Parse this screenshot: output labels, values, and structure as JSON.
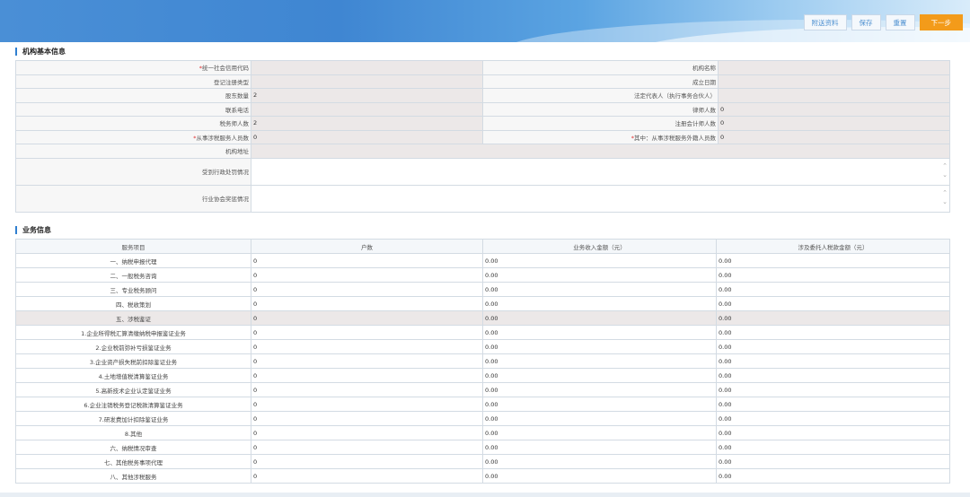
{
  "toolbar": {
    "attach_label": "附送资料",
    "save_label": "保存",
    "reset_label": "重置",
    "next_label": "下一步"
  },
  "info_section": {
    "title": "机构基本信息",
    "rows": [
      {
        "left_label": "统一社会信用代码",
        "left_required": true,
        "left_value": "",
        "right_label": "机构名称",
        "right_required": false,
        "right_value": ""
      },
      {
        "left_label": "登记注册类型",
        "left_required": false,
        "left_value": "",
        "right_label": "成立日期",
        "right_required": false,
        "right_value": ""
      },
      {
        "left_label": "股东数量",
        "left_required": false,
        "left_value": "2",
        "right_label": "法定代表人（执行事务合伙人）",
        "right_required": false,
        "right_value": ""
      },
      {
        "left_label": "联系电话",
        "left_required": false,
        "left_value": "",
        "right_label": "律师人数",
        "right_required": false,
        "right_value": "0"
      },
      {
        "left_label": "税务师人数",
        "left_required": false,
        "left_value": "2",
        "right_label": "注册会计师人数",
        "right_required": false,
        "right_value": "0"
      },
      {
        "left_label": "从事涉税服务人员数",
        "left_required": true,
        "left_value": "0",
        "right_label": "其中：从事涉税服务外籍人员数",
        "right_required": true,
        "right_value": "0"
      }
    ],
    "address_label": "机构地址",
    "address_value": "",
    "penalty_label": "受到行政处罚情况",
    "award_label": "行业协会奖惩情况"
  },
  "biz_section": {
    "title": "业务信息",
    "headers": [
      "服务项目",
      "户数",
      "业务收入金额（元）",
      "涉及委托人税款金额（元）"
    ],
    "rows": [
      {
        "item": "一、纳税申报代理",
        "count": "0",
        "income": "0.00",
        "tax": "0.00"
      },
      {
        "item": "二、一般税务咨询",
        "count": "0",
        "income": "0.00",
        "tax": "0.00"
      },
      {
        "item": "三、专业税务顾问",
        "count": "0",
        "income": "0.00",
        "tax": "0.00"
      },
      {
        "item": "四、税收策划",
        "count": "0",
        "income": "0.00",
        "tax": "0.00"
      },
      {
        "item": "五、涉税鉴证",
        "count": "0",
        "income": "0.00",
        "tax": "0.00"
      },
      {
        "item": "1.企业所得税汇算清缴纳税申报鉴证业务",
        "count": "0",
        "income": "0.00",
        "tax": "0.00"
      },
      {
        "item": "2.企业税前弥补亏损鉴证业务",
        "count": "0",
        "income": "0.00",
        "tax": "0.00"
      },
      {
        "item": "3.企业资产损失税前扣除鉴证业务",
        "count": "0",
        "income": "0.00",
        "tax": "0.00"
      },
      {
        "item": "4.土地增值税清算鉴证业务",
        "count": "0",
        "income": "0.00",
        "tax": "0.00"
      },
      {
        "item": "5.高新技术企业认定鉴证业务",
        "count": "0",
        "income": "0.00",
        "tax": "0.00"
      },
      {
        "item": "6.企业注销税务登记税款清算鉴证业务",
        "count": "0",
        "income": "0.00",
        "tax": "0.00"
      },
      {
        "item": "7.研发费加计扣除鉴证业务",
        "count": "0",
        "income": "0.00",
        "tax": "0.00"
      },
      {
        "item": "8.其他",
        "count": "0",
        "income": "0.00",
        "tax": "0.00"
      },
      {
        "item": "六、纳税情况审查",
        "count": "0",
        "income": "0.00",
        "tax": "0.00"
      },
      {
        "item": "七、其他税务事项代理",
        "count": "0",
        "income": "0.00",
        "tax": "0.00"
      },
      {
        "item": "八、其他涉税服务",
        "count": "0",
        "income": "0.00",
        "tax": "0.00"
      }
    ]
  }
}
